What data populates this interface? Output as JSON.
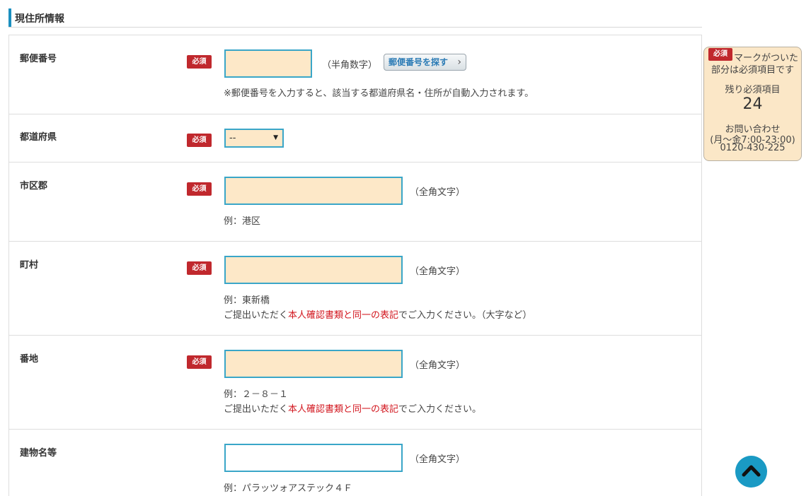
{
  "section": {
    "title": "現住所情報"
  },
  "required_badge": "必須",
  "fields": {
    "postal": {
      "label": "郵便番号",
      "value": "",
      "hint": "（半角数字）",
      "search_button": "郵便番号を探す",
      "note": "※郵便番号を入力すると、該当する都道府県名・住所が自動入力されます。"
    },
    "prefecture": {
      "label": "都道府県",
      "selected": "--"
    },
    "city": {
      "label": "市区郡",
      "value": "",
      "hint": "（全角文字）",
      "example": "例：港区"
    },
    "town": {
      "label": "町村",
      "value": "",
      "hint": "（全角文字）",
      "example": "例：東新橋",
      "note_prefix": "ご提出いただく",
      "note_red": "本人確認書類と同一の表記",
      "note_suffix": "でご入力ください。（大字など）"
    },
    "block": {
      "label": "番地",
      "value": "",
      "hint": "（全角文字）",
      "example": "例：２－８－１",
      "note_prefix": "ご提出いただく",
      "note_red": "本人確認書類と同一の表記",
      "note_suffix": "でご入力ください。"
    },
    "building": {
      "label": "建物名等",
      "value": "",
      "hint": "（全角文字）",
      "example": "例：パラッツォアステック４Ｆ"
    }
  },
  "side_panel": {
    "line1": "マークがついた",
    "line2": "部分は必須項目です",
    "remaining_label": "残り必須項目",
    "remaining_count": "24",
    "contact_label": "お問い合わせ",
    "contact_hours": "(月～金7:00-23:00)",
    "contact_phone": "0120-430-225"
  },
  "colors": {
    "required": "#c0282d",
    "input_fill": "#fde8c8",
    "input_border": "#3aa6c8",
    "accent": "#1a9ac4",
    "highlight_text": "#d2161e"
  },
  "icons": {
    "scroll_top": "chevron-up-icon",
    "search_button": "chevron-right-icon",
    "select": "caret-down-icon"
  }
}
